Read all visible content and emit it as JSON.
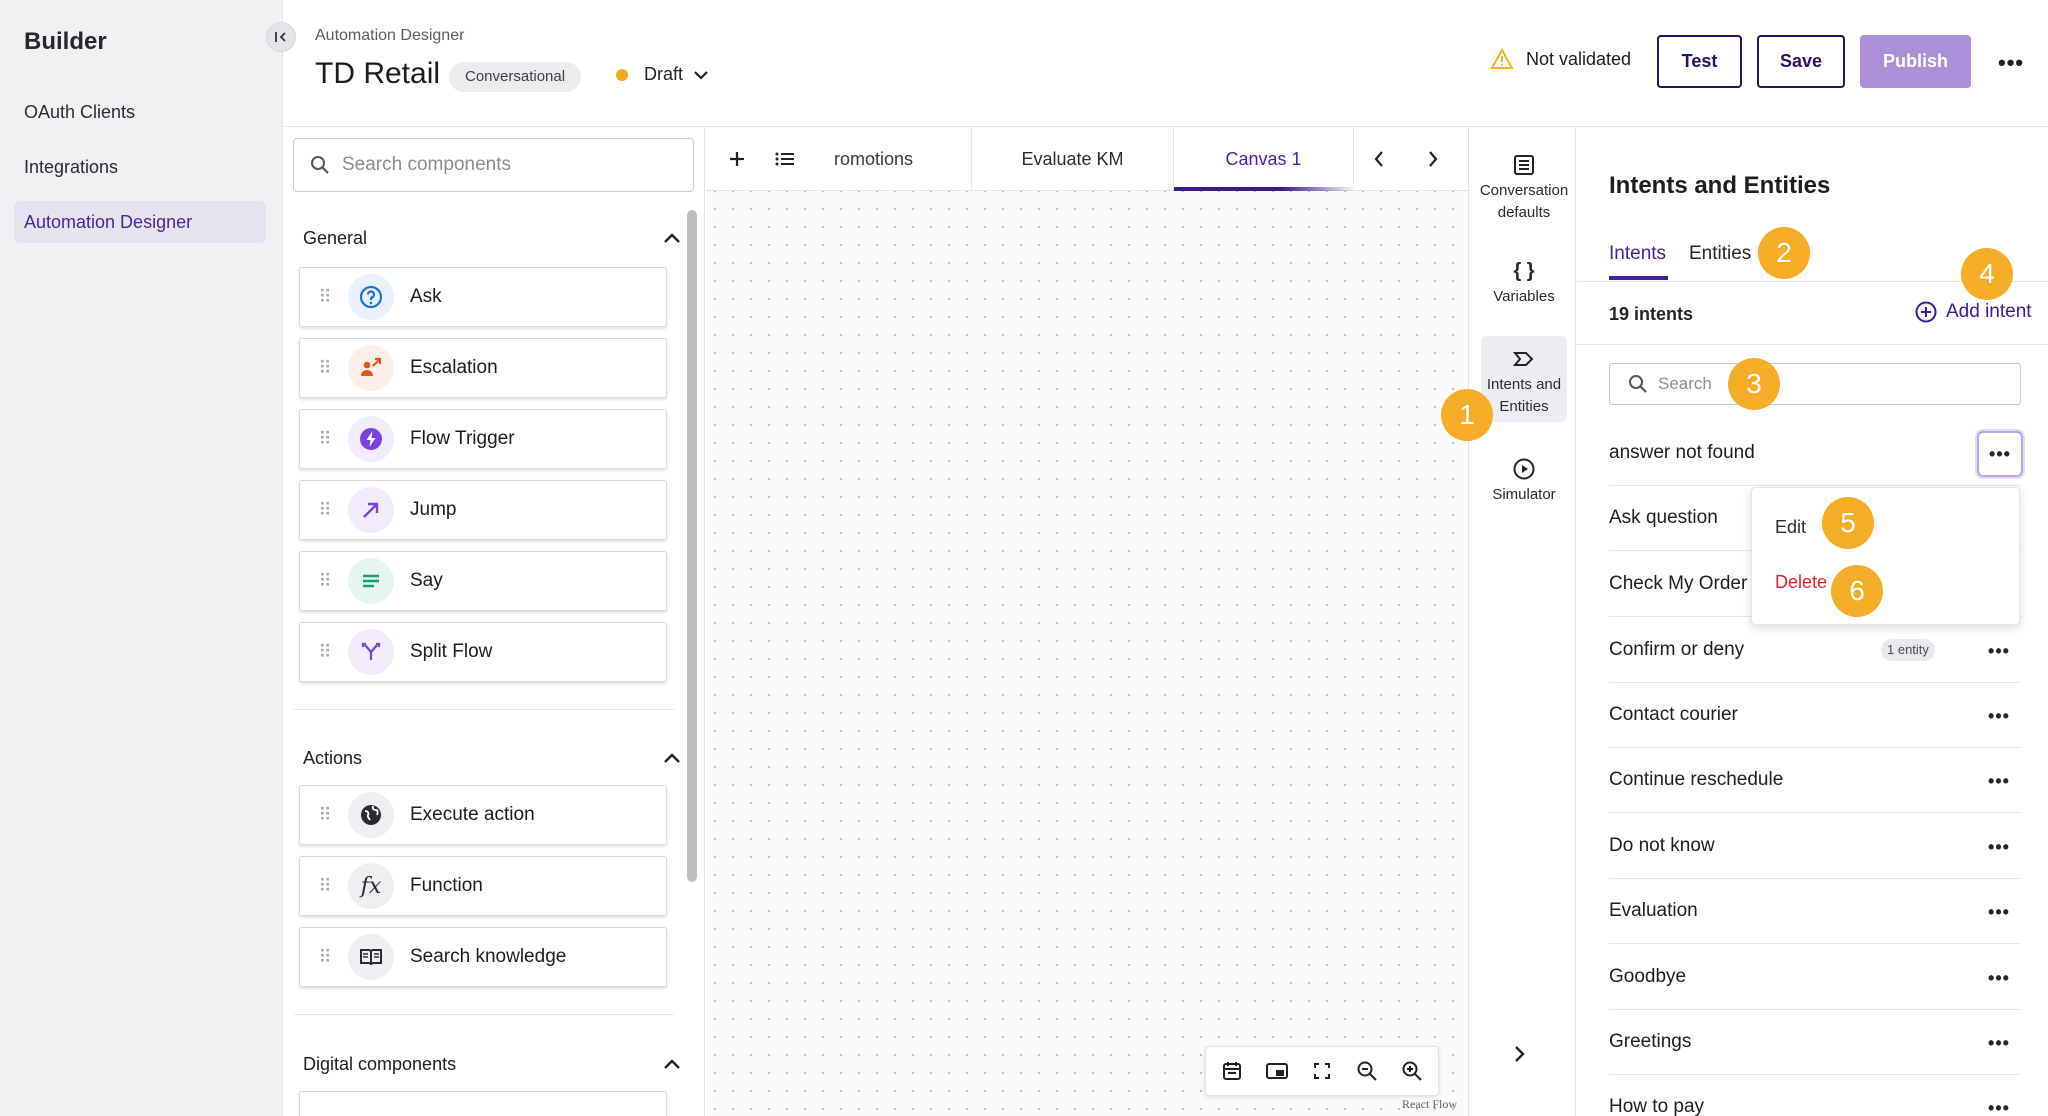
{
  "sidebar": {
    "brand": "Builder",
    "items": [
      {
        "label": "OAuth Clients"
      },
      {
        "label": "Integrations"
      },
      {
        "label": "Automation Designer"
      }
    ]
  },
  "header": {
    "breadcrumb": "Automation Designer",
    "title": "TD Retail",
    "tag": "Conversational",
    "status": "Draft",
    "validation": "Not validated",
    "buttons": {
      "test": "Test",
      "save": "Save",
      "publish": "Publish"
    }
  },
  "components": {
    "search_placeholder": "Search components",
    "groups": [
      {
        "title": "General",
        "items": [
          {
            "label": "Ask",
            "icon": "question-icon"
          },
          {
            "label": "Escalation",
            "icon": "escalation-icon"
          },
          {
            "label": "Flow Trigger",
            "icon": "lightning-icon"
          },
          {
            "label": "Jump",
            "icon": "arrow-up-right-icon"
          },
          {
            "label": "Say",
            "icon": "lines-icon"
          },
          {
            "label": "Split Flow",
            "icon": "split-icon"
          }
        ]
      },
      {
        "title": "Actions",
        "items": [
          {
            "label": "Execute action",
            "icon": "globe-icon"
          },
          {
            "label": "Function",
            "icon": "function-icon"
          },
          {
            "label": "Search knowledge",
            "icon": "book-icon"
          }
        ]
      },
      {
        "title": "Digital components",
        "items": []
      }
    ]
  },
  "canvas": {
    "tabs": [
      "romotions",
      "Evaluate KM",
      "Canvas 1"
    ],
    "active_tab": "Canvas 1",
    "watermark": "React Flow"
  },
  "rail": {
    "items": [
      {
        "label": "Conversation defaults",
        "icon": "list-icon"
      },
      {
        "label": "Variables",
        "icon": "braces-icon"
      },
      {
        "label": "Intents and Entities",
        "icon": "intent-icon"
      },
      {
        "label": "Simulator",
        "icon": "play-circle-icon"
      }
    ]
  },
  "intents_panel": {
    "title": "Intents and Entities",
    "tabs": [
      "Intents",
      "Entities"
    ],
    "count": "19 intents",
    "add_label": "Add intent",
    "search_placeholder": "Search",
    "intents": [
      {
        "name": "answer not found"
      },
      {
        "name": "Ask question"
      },
      {
        "name": "Check My Order"
      },
      {
        "name": "Confirm or deny",
        "badge": "1 entity"
      },
      {
        "name": "Contact courier"
      },
      {
        "name": "Continue reschedule"
      },
      {
        "name": "Do not know"
      },
      {
        "name": "Evaluation"
      },
      {
        "name": "Goodbye"
      },
      {
        "name": "Greetings"
      },
      {
        "name": "How to pay"
      }
    ],
    "menu": {
      "edit": "Edit",
      "delete": "Delete"
    }
  },
  "callouts": [
    "1",
    "2",
    "3",
    "4",
    "5",
    "6"
  ],
  "colors": {
    "brand_purple": "#44209c",
    "publish_bg": "#ad8fd8",
    "callout": "#f5ac27",
    "delete_red": "#e0232b",
    "draft_dot": "#eeac1c"
  }
}
